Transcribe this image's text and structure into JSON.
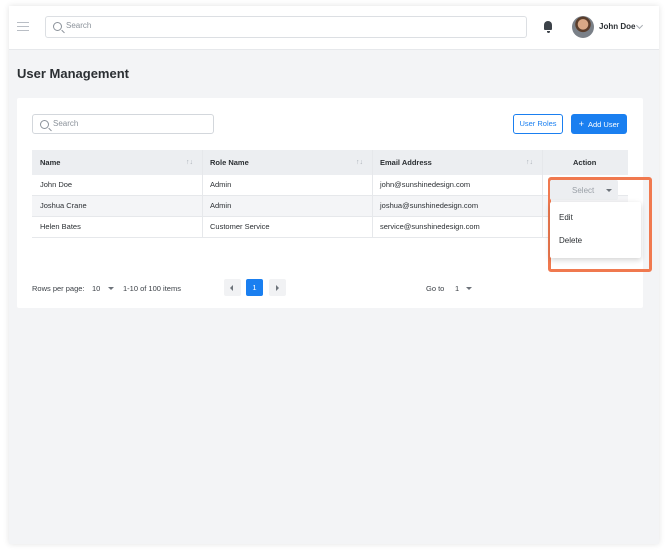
{
  "header": {
    "search_placeholder": "Search",
    "user_name": "John Doe",
    "avatar_icon": "user-avatar-photo"
  },
  "page": {
    "title": "User Management"
  },
  "toolbar": {
    "search_placeholder": "Search",
    "user_roles_label": "User Roles",
    "add_user_label": "Add User",
    "add_user_icon": "+"
  },
  "table": {
    "columns": [
      "Name",
      "Role Name",
      "Email Address",
      "Action"
    ],
    "sort_icon": "↑↓",
    "rows": [
      {
        "name": "John Doe",
        "role": "Admin",
        "email": "john@sunshinedesign.com"
      },
      {
        "name": "Joshua Crane",
        "role": "Admin",
        "email": "joshua@sunshinedesign.com"
      },
      {
        "name": "Helen Bates",
        "role": "Customer Service",
        "email": "service@sunshinedesign.com"
      }
    ]
  },
  "action_menu": {
    "select_label": "Select",
    "items": [
      "Edit",
      "Delete"
    ],
    "highlight_color": "#f0794f"
  },
  "pagination": {
    "rows_per_page_label": "Rows per page:",
    "rows_per_page_value": "10",
    "range_text": "1-10 of 100 items",
    "current_page": "1",
    "goto_label": "Go to",
    "goto_value": "1"
  },
  "colors": {
    "accent": "#1a7ff0",
    "background": "#f3f4f6"
  }
}
